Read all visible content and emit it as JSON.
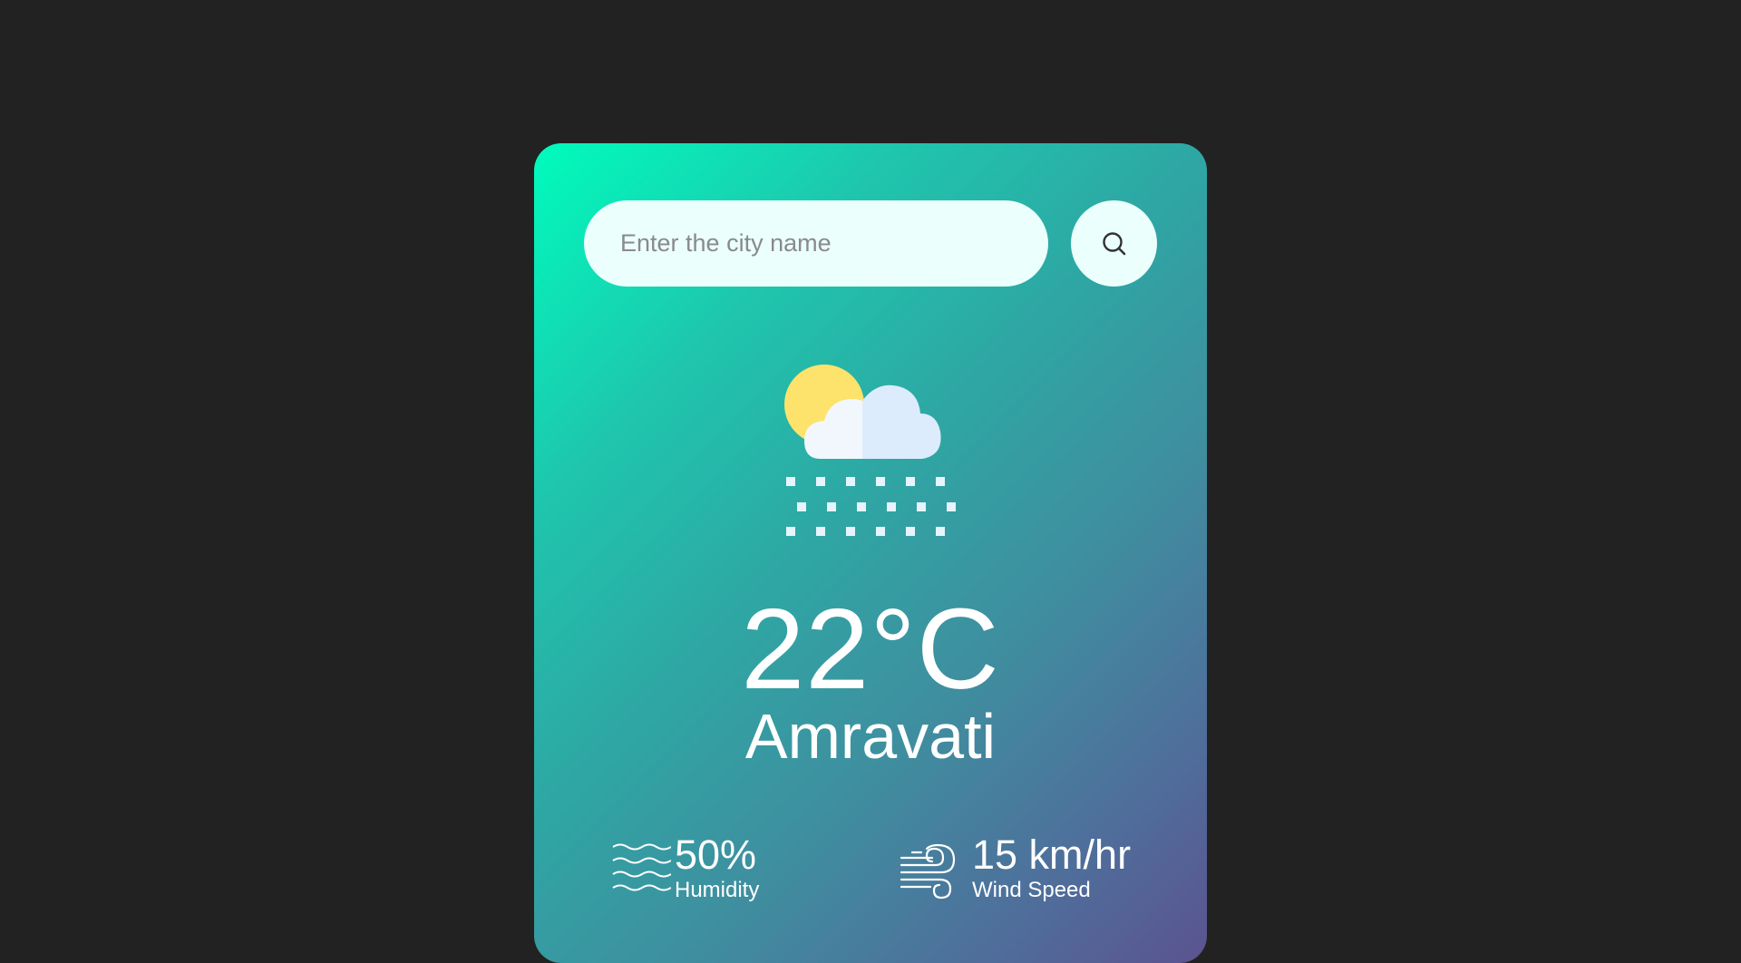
{
  "search": {
    "placeholder": "Enter the city name",
    "value": ""
  },
  "weather": {
    "icon": "snow-cloud-sun-icon",
    "temperature": "22°C",
    "city": "Amravati"
  },
  "details": {
    "humidity": {
      "icon": "humidity-waves-icon",
      "value": "50%",
      "label": "Humidity"
    },
    "wind": {
      "icon": "wind-icon",
      "value": "15 km/hr",
      "label": "Wind Speed"
    }
  },
  "colors": {
    "page_background": "#222222",
    "card_gradient_start": "#00fcbd",
    "card_gradient_end": "#5b5390",
    "input_background": "#ebfffc",
    "text": "#ffffff"
  }
}
